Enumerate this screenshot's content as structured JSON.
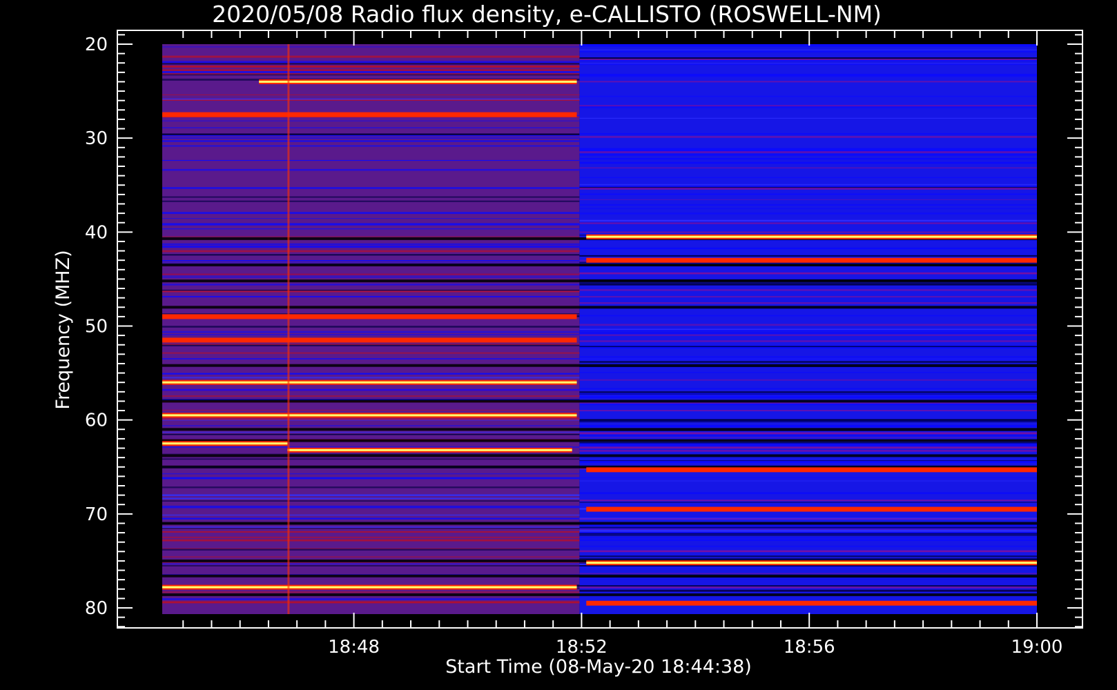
{
  "chart_data": {
    "type": "heatmap",
    "title": "2020/05/08  Radio flux density, e-CALLISTO (ROSWELL-NM)",
    "xlabel": "Start Time (08-May-20 18:44:38)",
    "ylabel": "Frequency (MHZ)",
    "x_range": [
      "18:44:38",
      "19:00:00"
    ],
    "y_range": [
      20,
      80
    ],
    "y_inverted": true,
    "x_ticks": [
      "18:48",
      "18:52",
      "18:56",
      "19:00"
    ],
    "y_ticks": [
      20,
      30,
      40,
      50,
      60,
      70,
      80
    ],
    "colormap": [
      "#000000",
      "#0000ff",
      "#c80000",
      "#ff3000",
      "#ffff60"
    ],
    "background_colors": {
      "early_segment": "#5a1a8c",
      "late_segment": "#1616e6"
    },
    "segment_break_time": "18:52",
    "bright_bands": [
      {
        "freq": 24,
        "start": "18:46:20",
        "end": "18:51:55",
        "level": "bright"
      },
      {
        "freq": 27.5,
        "start": "18:44:38",
        "end": "18:51:55",
        "level": "medium"
      },
      {
        "freq": 40.5,
        "start": "18:52:05",
        "end": "19:00:00",
        "level": "bright"
      },
      {
        "freq": 43,
        "start": "18:52:05",
        "end": "19:00:00",
        "level": "medium"
      },
      {
        "freq": 49,
        "start": "18:44:38",
        "end": "18:51:55",
        "level": "medium"
      },
      {
        "freq": 51.5,
        "start": "18:44:38",
        "end": "18:51:55",
        "level": "medium"
      },
      {
        "freq": 56,
        "start": "18:44:38",
        "end": "18:51:55",
        "level": "bright"
      },
      {
        "freq": 59.5,
        "start": "18:44:38",
        "end": "18:51:55",
        "level": "bright"
      },
      {
        "freq": 62.5,
        "start": "18:44:38",
        "end": "18:46:50",
        "level": "bright"
      },
      {
        "freq": 63.2,
        "start": "18:46:50",
        "end": "18:51:50",
        "level": "bright"
      },
      {
        "freq": 65.3,
        "start": "18:52:05",
        "end": "19:00:00",
        "level": "medium"
      },
      {
        "freq": 69.5,
        "start": "18:52:05",
        "end": "19:00:00",
        "level": "medium"
      },
      {
        "freq": 75.2,
        "start": "18:52:05",
        "end": "19:00:00",
        "level": "bright"
      },
      {
        "freq": 77.8,
        "start": "18:44:38",
        "end": "18:51:55",
        "level": "bright"
      },
      {
        "freq": 79.5,
        "start": "18:52:05",
        "end": "19:00:00",
        "level": "medium"
      }
    ],
    "dark_bands": [
      40.7,
      43.5,
      45.2,
      48.0,
      54.2,
      58.0,
      61.0,
      62.2,
      63.8,
      65.0,
      71.0,
      75.0,
      76.6,
      78.6
    ],
    "grid": false,
    "legend": "none"
  }
}
